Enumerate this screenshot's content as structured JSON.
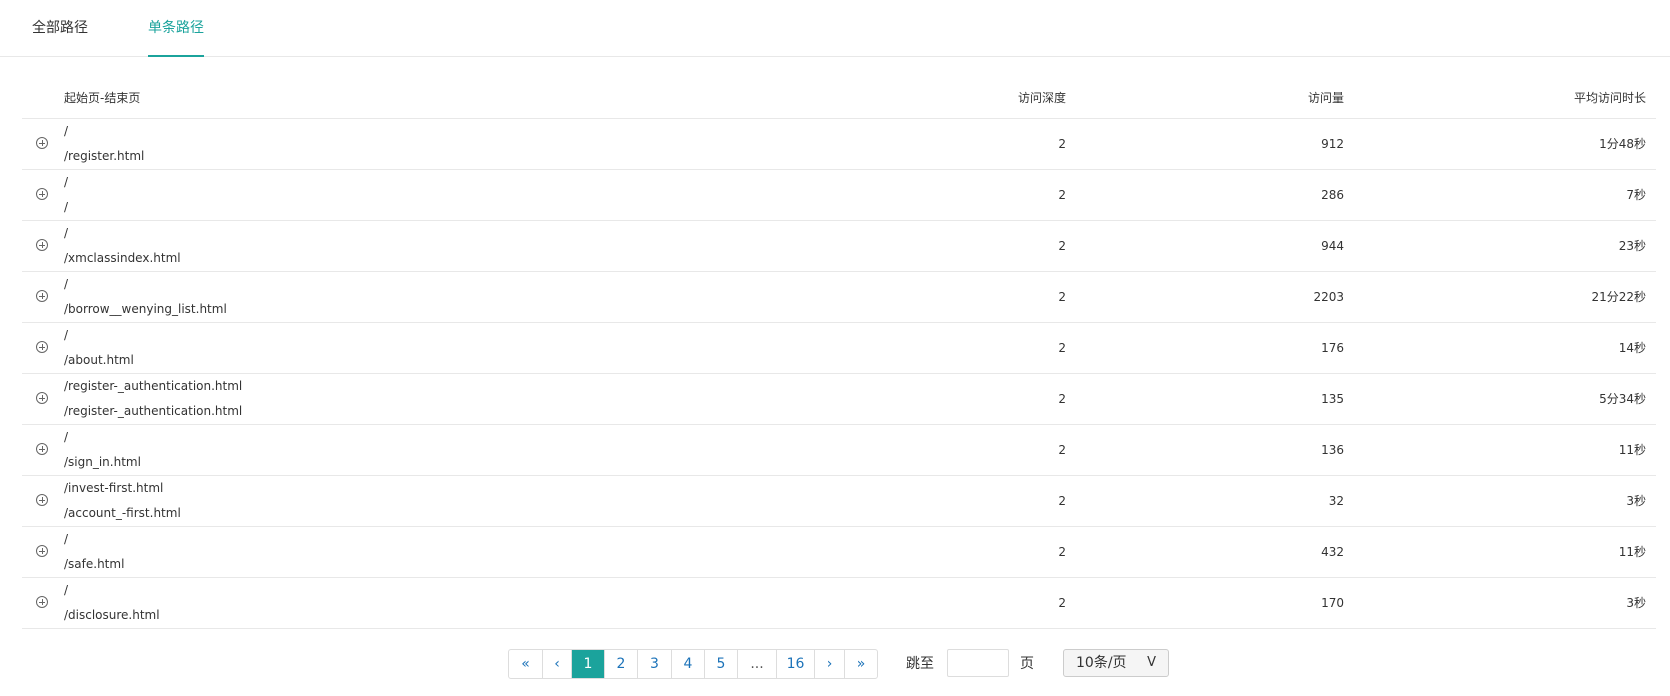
{
  "tabs": [
    {
      "label": "全部路径"
    },
    {
      "label": "单条路径"
    }
  ],
  "columns": {
    "path": "起始页-结束页",
    "depth": "访问深度",
    "visits": "访问量",
    "avg_duration": "平均访问时长"
  },
  "rows": [
    {
      "start": "/",
      "end": "/register.html",
      "depth": "2",
      "visits": "912",
      "duration": "1分48秒"
    },
    {
      "start": "/",
      "end": "/",
      "depth": "2",
      "visits": "286",
      "duration": "7秒"
    },
    {
      "start": "/",
      "end": "/xmclassindex.html",
      "depth": "2",
      "visits": "944",
      "duration": "23秒"
    },
    {
      "start": "/",
      "end": "/borrow__wenying_list.html",
      "depth": "2",
      "visits": "2203",
      "duration": "21分22秒"
    },
    {
      "start": "/",
      "end": "/about.html",
      "depth": "2",
      "visits": "176",
      "duration": "14秒"
    },
    {
      "start": "/register-_authentication.html",
      "end": "/register-_authentication.html",
      "depth": "2",
      "visits": "135",
      "duration": "5分34秒"
    },
    {
      "start": "/",
      "end": "/sign_in.html",
      "depth": "2",
      "visits": "136",
      "duration": "11秒"
    },
    {
      "start": "/invest-first.html",
      "end": "/account_-first.html",
      "depth": "2",
      "visits": "32",
      "duration": "3秒"
    },
    {
      "start": "/",
      "end": "/safe.html",
      "depth": "2",
      "visits": "432",
      "duration": "11秒"
    },
    {
      "start": "/",
      "end": "/disclosure.html",
      "depth": "2",
      "visits": "170",
      "duration": "3秒"
    }
  ],
  "pagination": {
    "first": "«",
    "prev": "‹",
    "pages": [
      "1",
      "2",
      "3",
      "4",
      "5"
    ],
    "ellipsis": "...",
    "last_page": "16",
    "next": "›",
    "last": "»",
    "current": "1",
    "jump_label": "跳至",
    "page_label": "页",
    "page_size": "10条/页",
    "page_size_arrow": "V"
  },
  "colors": {
    "accent": "#1ba39c",
    "link": "#1c73b9"
  }
}
